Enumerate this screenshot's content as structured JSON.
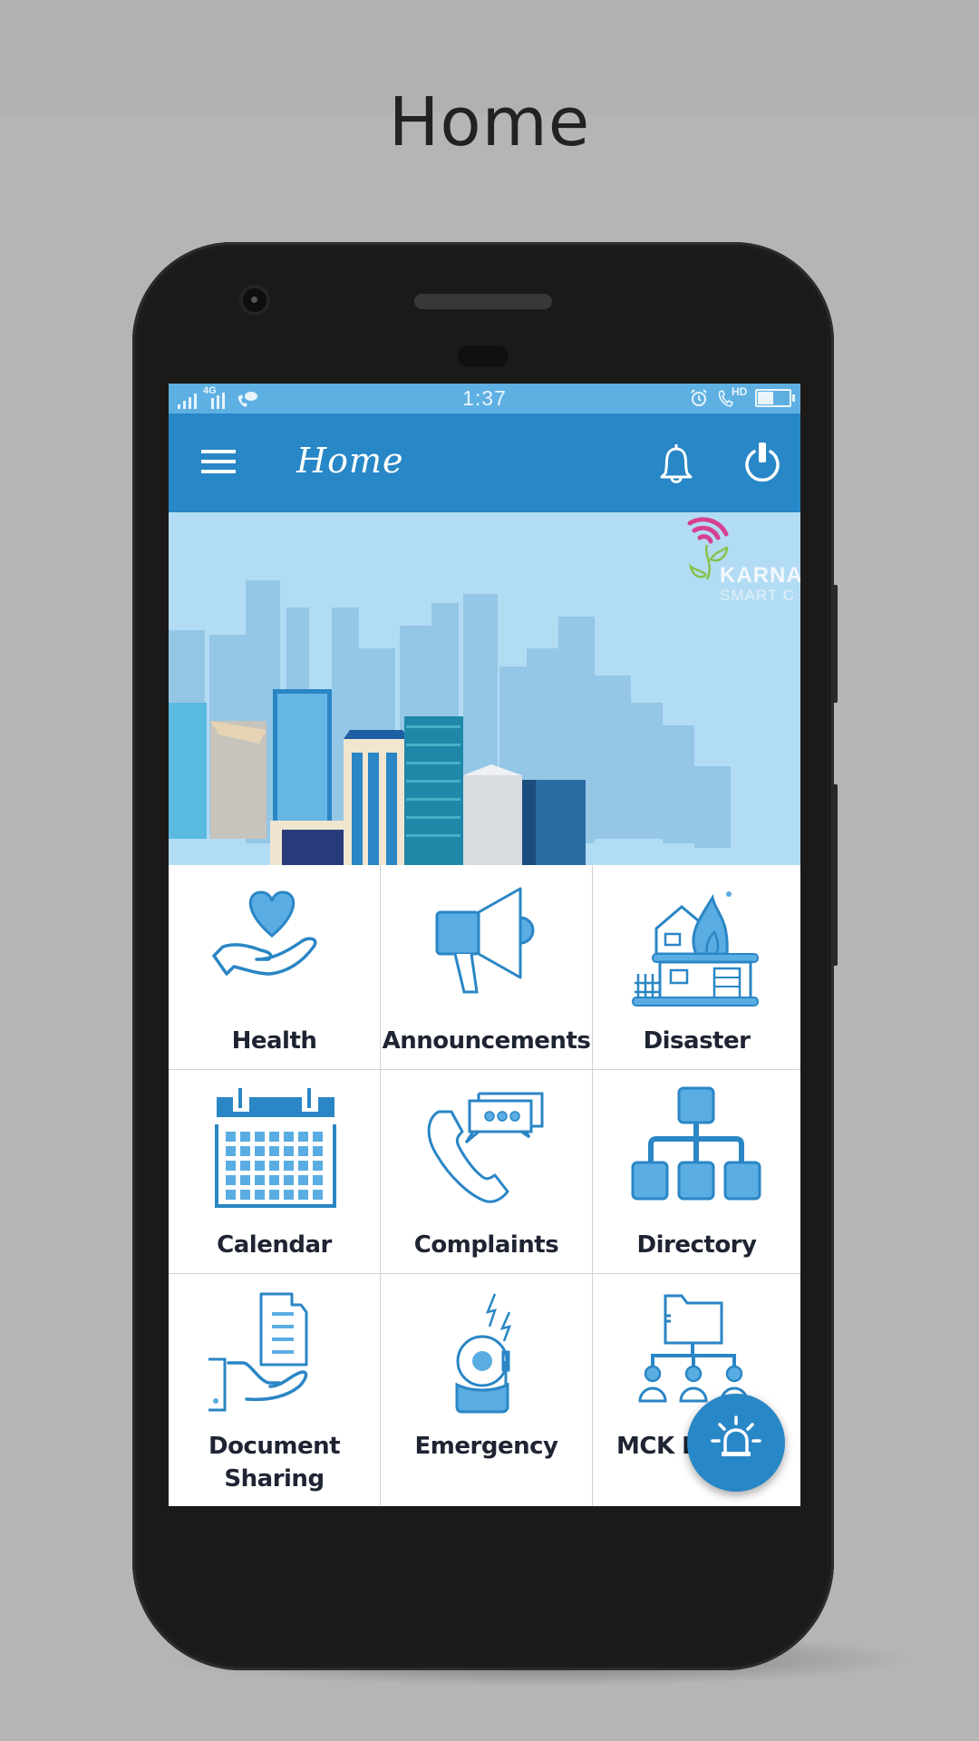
{
  "page": {
    "title": "Home"
  },
  "status_bar": {
    "time": "1:37",
    "network_label": "4G",
    "call_label": "HD",
    "battery_level_percent": 50,
    "icons": [
      "signal-icon",
      "signal-4g-icon",
      "wifi-calling-icon",
      "alarm-icon",
      "volte-hd-icon",
      "battery-icon"
    ]
  },
  "app_bar": {
    "title": "Home",
    "left_icon": "menu-icon",
    "right_icons": [
      "notification-bell-icon",
      "power-icon"
    ]
  },
  "banner": {
    "logo_text": "KARNA",
    "logo_subtext": "SMART C"
  },
  "colors": {
    "primary": "#2887c6",
    "status_bar": "#5eb0e3",
    "icon_fill": "#5aade2",
    "icon_stroke": "#2a86c5",
    "label": "#1f2433"
  },
  "grid": {
    "items": [
      {
        "label": "Health",
        "icon": "heart-in-hand-icon"
      },
      {
        "label": "Announcements",
        "icon": "megaphone-icon"
      },
      {
        "label": "Disaster",
        "icon": "house-fire-icon"
      },
      {
        "label": "Calendar",
        "icon": "calendar-icon"
      },
      {
        "label": "Complaints",
        "icon": "phone-chat-icon"
      },
      {
        "label": "Directory",
        "icon": "hierarchy-icon"
      },
      {
        "label": "Document Sharing",
        "icon": "document-hand-icon",
        "label_line1": "Document",
        "label_line2": "Sharing"
      },
      {
        "label": "Emergency",
        "icon": "alarm-bell-icon"
      },
      {
        "label": "MCK D",
        "icon": "folder-people-icon"
      }
    ]
  },
  "fab": {
    "icon": "siren-icon"
  }
}
